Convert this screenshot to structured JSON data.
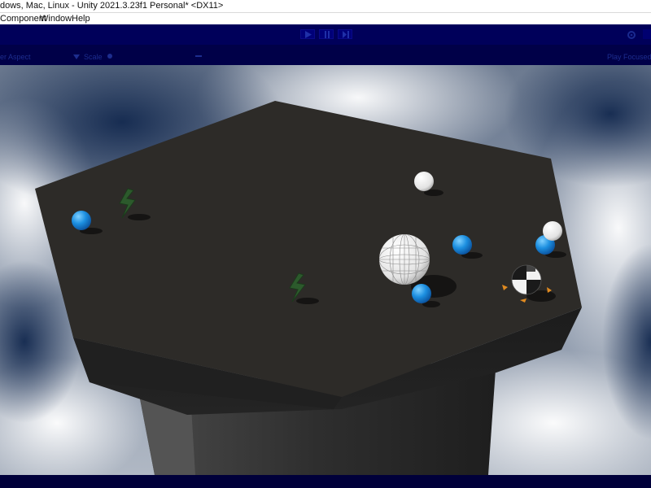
{
  "window": {
    "title": "dows, Mac, Linux - Unity 2021.3.23f1 Personal* <DX11>"
  },
  "menu": {
    "items": [
      "Component",
      "Window",
      "Help"
    ]
  },
  "toolbar": {
    "play_icon": "play-icon",
    "pause_icon": "pause-icon",
    "step_icon": "step-icon",
    "settings_icon": "gear-icon"
  },
  "scenebar": {
    "left_label": "er Aspect",
    "scale_label": "Scale",
    "right_label": "Play Focused"
  },
  "colors": {
    "toolbar_bg": "#00005a",
    "scenebar_bg": "#000048",
    "platform_top": "#2d2b28",
    "sphere_blue": "#1c8fe0",
    "sphere_white": "#f0f0f0",
    "lightning": "#2c5a2c",
    "footprint": "#e08a20"
  }
}
